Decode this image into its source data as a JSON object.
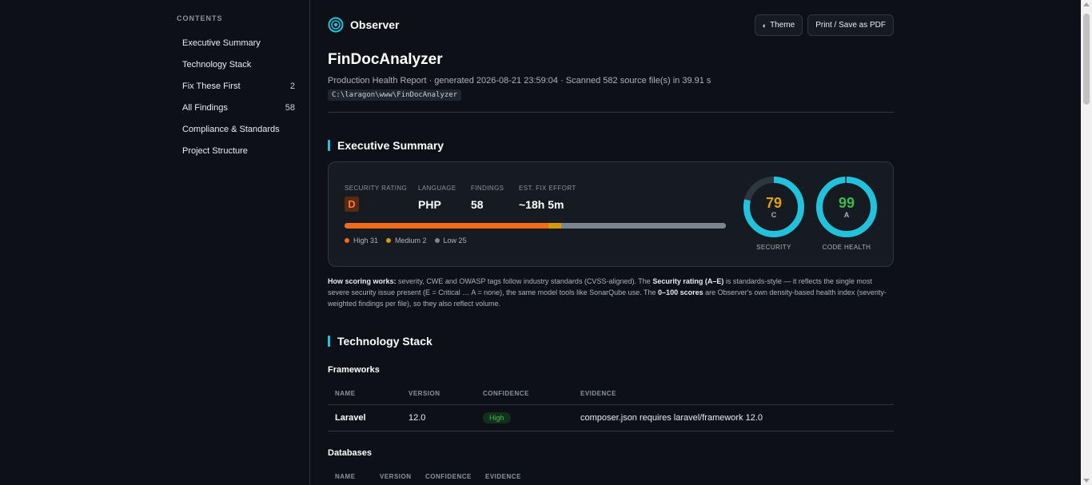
{
  "sidebar": {
    "title": "CONTENTS",
    "items": [
      {
        "label": "Executive Summary",
        "count": ""
      },
      {
        "label": "Technology Stack",
        "count": ""
      },
      {
        "label": "Fix These First",
        "count": "2"
      },
      {
        "label": "All Findings",
        "count": "58"
      },
      {
        "label": "Compliance & Standards",
        "count": ""
      },
      {
        "label": "Project Structure",
        "count": ""
      }
    ]
  },
  "header": {
    "brand": "Observer",
    "theme_icon": "◐",
    "theme_label": "Theme",
    "print_label": "Print / Save as PDF",
    "project": "FinDocAnalyzer",
    "subtitle": "Production Health Report · generated 2026-08-21 23:59:04 · Scanned 582 source file(s) in 39.91 s",
    "path": "C:\\laragon\\www\\FinDocAnalyzer"
  },
  "summary": {
    "heading": "Executive Summary",
    "security_rating_label": "SECURITY RATING",
    "security_rating": "D",
    "language_label": "LANGUAGE",
    "language": "PHP",
    "findings_label": "FINDINGS",
    "findings": "58",
    "effort_label": "EST. FIX EFFORT",
    "effort": "~18h 5m",
    "severity": {
      "high": {
        "label": "High 31",
        "value": 31,
        "color": "#f36b16"
      },
      "medium": {
        "label": "Medium 2",
        "value": 2,
        "color": "#d39a0a"
      },
      "low": {
        "label": "Low 25",
        "value": 25,
        "color": "#7d8590"
      }
    },
    "gauges": [
      {
        "score": "79",
        "value": 79,
        "grade": "C",
        "label": "SECURITY",
        "color": "#e3a008"
      },
      {
        "score": "99",
        "value": 99,
        "grade": "A",
        "label": "CODE HEALTH",
        "color": "#3fb950"
      }
    ],
    "note": {
      "p1_bold": "How scoring works:",
      "p1": " severity, CWE and OWASP tags follow industry standards (CVSS-aligned). The ",
      "p2_bold": "Security rating (A–E)",
      "p2": " is standards-style — it reflects the single most severe security issue present (E = Critical … A = none), the same model tools like SonarQube use. The ",
      "p3_bold": "0–100 scores",
      "p3": " are Observer's own density-based health index (severity-weighted findings per file), so they also reflect volume."
    }
  },
  "tech": {
    "heading": "Technology Stack",
    "frameworks_heading": "Frameworks",
    "frameworks_columns": [
      "NAME",
      "VERSION",
      "CONFIDENCE",
      "EVIDENCE"
    ],
    "frameworks_rows": [
      {
        "name": "Laravel",
        "version": "12.0",
        "confidence": "High",
        "evidence": "composer.json requires laravel/framework 12.0"
      }
    ],
    "databases_heading": "Databases",
    "databases_columns": [
      "NAME",
      "VERSION",
      "CONFIDENCE",
      "EVIDENCE"
    ]
  },
  "colors": {
    "accent": "#22c1dc",
    "ring_track": "#2d3742"
  }
}
